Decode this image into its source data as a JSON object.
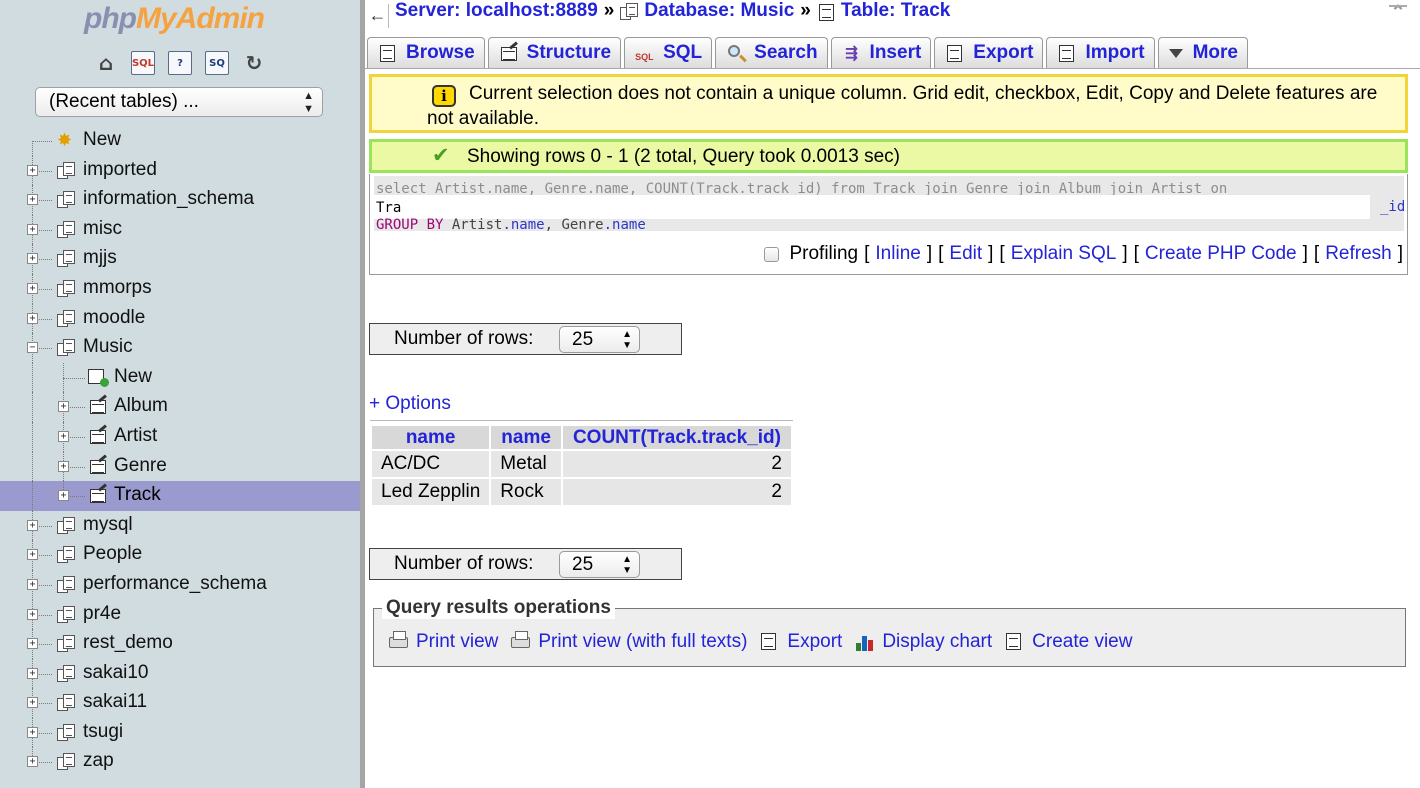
{
  "sidebar": {
    "logo_php": "php",
    "logo_myadmin": "MyAdmin",
    "quick_icons": [
      "home-icon",
      "sql-query-icon",
      "docs-icon",
      "sql-docs-icon",
      "reload-icon"
    ],
    "recent_tables": "(Recent tables) ...",
    "tree": {
      "new": "New",
      "databases_before": [
        "imported",
        "information_schema",
        "misc",
        "mjjs",
        "mmorps",
        "moodle"
      ],
      "music": "Music",
      "music_children": {
        "new": "New",
        "tables": [
          "Album",
          "Artist",
          "Genre",
          "Track"
        ]
      },
      "databases_after": [
        "mysql",
        "People",
        "performance_schema",
        "pr4e",
        "rest_demo",
        "sakai10",
        "sakai11",
        "tsugi",
        "zap"
      ]
    }
  },
  "breadcrumb": {
    "server": "Server: localhost:8889",
    "database": "Database: Music",
    "table": "Table: Track",
    "sep": "»"
  },
  "tabs": [
    "Browse",
    "Structure",
    "SQL",
    "Search",
    "Insert",
    "Export",
    "Import",
    "More"
  ],
  "notice": "Current selection does not contain a unique column. Grid edit, checkbox, Edit, Copy and Delete features are not available.",
  "success": "Showing rows 0 - 1 (2 total, Query took 0.0013 sec)",
  "sql": {
    "line1": "select Artist.name, Genre.name, COUNT(Track.track_id) from Track join Genre join Album join Artist on",
    "line2_visible": "Tra",
    "line2_end": "_id",
    "line3_kw1": "GROUP BY",
    "line3_a": "Artist",
    "line3_a_col": ".name",
    "line3_b": "Genre",
    "line3_b_col": ".name"
  },
  "sql_links": {
    "profiling": "Profiling",
    "inline": "Inline",
    "edit": "Edit",
    "explain": "Explain SQL",
    "php": "Create PHP Code",
    "refresh": "Refresh",
    "open": "[",
    "close": "]"
  },
  "rows_control": {
    "label": "Number of rows:",
    "value": "25"
  },
  "options_link": "+ Options",
  "results": {
    "headers": [
      "name",
      "name",
      "COUNT(Track.track_id)"
    ],
    "rows": [
      [
        "AC/DC",
        "Metal",
        "2"
      ],
      [
        "Led Zepplin",
        "Rock",
        "2"
      ]
    ]
  },
  "ops": {
    "legend": "Query results operations",
    "items": [
      "Print view",
      "Print view (with full texts)",
      "Export",
      "Display chart",
      "Create view"
    ]
  }
}
